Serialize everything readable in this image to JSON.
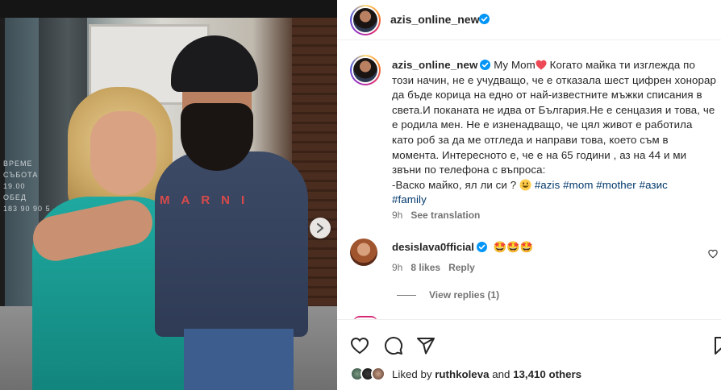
{
  "post": {
    "username": "azis_online_new"
  },
  "caption": {
    "username": "azis_online_new",
    "text_start": "My Mom",
    "text_body": "Когато майка ти изглежда по този начин, не е учудващо, че е отказала шест цифрен хонорар да бъде корица на едно от най-известните мъжки списания в света.И поканата не идва от България.Не е сенцазия и това, че е родила мен. Не е изненадващо, че цял живот е работила като роб за да ме отгледа и направи това, което съм в момента. Интересното е, че е на 65 години , аз на 44 и ми звъни по телефона с въпроса:",
    "quote": "-Васко майко, ял ли си ?",
    "hashtags": [
      "#azis",
      "#mom",
      "#mother",
      "#азис",
      "#family"
    ],
    "time": "9h",
    "see_translation": "See translation"
  },
  "comment": {
    "username": "desislava0fficial",
    "text": "🤩🤩🤩",
    "time": "9h",
    "likes": "8 likes",
    "reply": "Reply"
  },
  "view_replies": "View replies (1)",
  "likes": {
    "prefix": "Liked by",
    "user": "ruthkoleva",
    "connector": "and",
    "others": "13,410 others"
  },
  "photo": {
    "sign_text": [
      "ВРЕМЕ",
      "СЪБОТА",
      "19.00",
      "ОБЕД",
      "183 90 90 5"
    ],
    "sweater_print": "MARNI"
  },
  "colors": {
    "verified": "#0095f6",
    "hashtag": "#00376b",
    "heart": "#ed4956",
    "muted": "#737373"
  },
  "icons": [
    "verified-badge-icon",
    "red-heart-icon",
    "grinning-emoji-icon",
    "star-eyes-emoji-icon",
    "like-heart-icon",
    "comment-icon",
    "share-icon",
    "save-icon",
    "next-arrow-icon"
  ]
}
